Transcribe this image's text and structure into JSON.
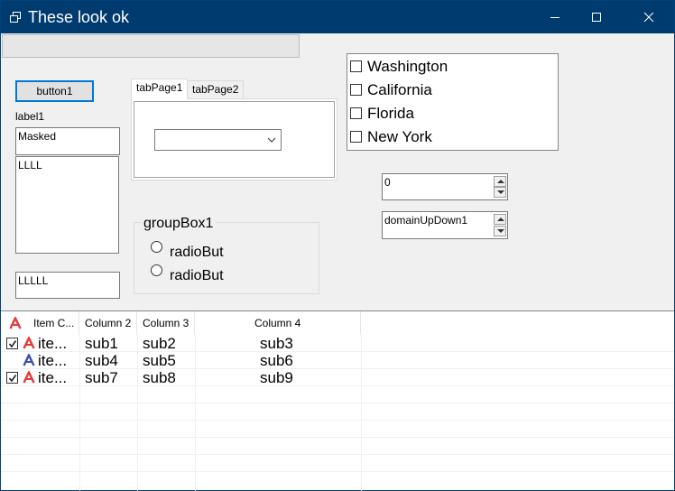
{
  "window": {
    "title": "These look ok"
  },
  "controls": {
    "button1": "button1",
    "label1": "label1",
    "masked_text": "Masked",
    "multiline_text": "LLLL",
    "text_lllll": "LLLLL"
  },
  "tabs": [
    {
      "label": "tabPage1"
    },
    {
      "label": "tabPage2"
    }
  ],
  "combobox": {
    "value": ""
  },
  "groupbox": {
    "title": "groupBox1",
    "radios": [
      {
        "label": "radioBut"
      },
      {
        "label": "radioBut"
      }
    ]
  },
  "checked_list": {
    "items": [
      {
        "label": "Washington",
        "checked": false
      },
      {
        "label": "California",
        "checked": false
      },
      {
        "label": "Florida",
        "checked": false
      },
      {
        "label": "New York",
        "checked": false
      }
    ]
  },
  "numeric_updown": {
    "value": "0"
  },
  "domain_updown": {
    "value": "domainUpDown1"
  },
  "listview": {
    "columns": [
      "Item C...",
      "Column 2",
      "Column 3",
      "Column 4"
    ],
    "rows": [
      {
        "checked": true,
        "icon": "letter-a-red-icon",
        "cells": [
          "ite...",
          "sub1",
          "sub2",
          "sub3"
        ]
      },
      {
        "checked": false,
        "icon": "letter-a-blue-icon",
        "cells": [
          "ite...",
          "sub4",
          "sub5",
          "sub6"
        ]
      },
      {
        "checked": true,
        "icon": "letter-a-red-icon",
        "cells": [
          "ite...",
          "sub7",
          "sub8",
          "sub9"
        ]
      }
    ]
  },
  "colors": {
    "titlebar": "#003b6f",
    "focus_border": "#0078d7",
    "icon_red": "#e53935",
    "icon_blue": "#3f51b5"
  }
}
